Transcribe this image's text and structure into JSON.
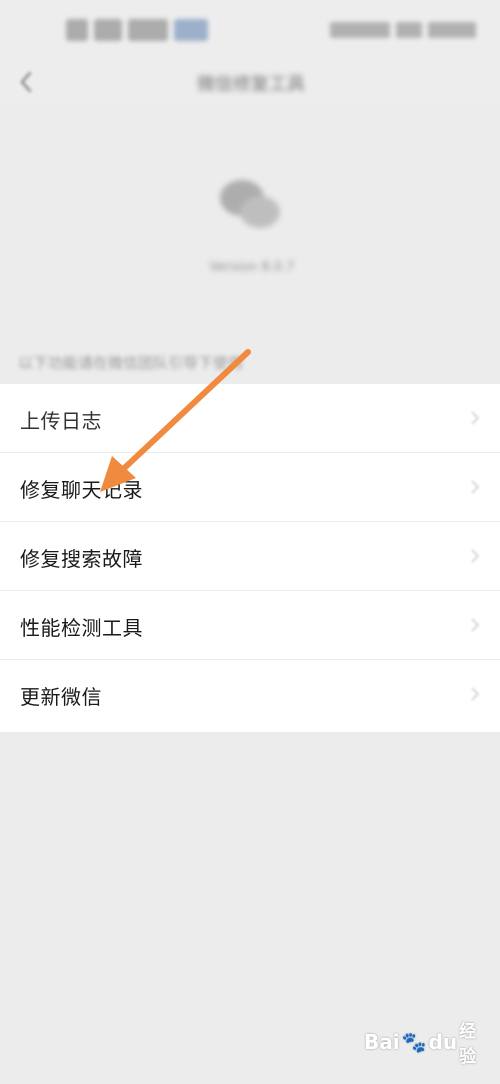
{
  "status_bar": {
    "time": "",
    "battery": ""
  },
  "nav": {
    "title": "微信修复工具",
    "back_icon": "chevron-left-icon"
  },
  "header": {
    "logo_icon": "wechat-logo-icon",
    "version": "Version 8.0.7"
  },
  "hint": "以下功能请在微信团队引导下使用",
  "menu": {
    "items": [
      {
        "label": "上传日志"
      },
      {
        "label": "修复聊天记录"
      },
      {
        "label": "修复搜索故障"
      },
      {
        "label": "性能检测工具"
      },
      {
        "label": "更新微信"
      }
    ],
    "chevron_icon": "chevron-right-icon"
  },
  "annotation": {
    "arrow_color": "#f08a3e",
    "arrow_icon": "annotation-arrow-icon"
  },
  "watermark": {
    "latin": "Bai",
    "paw": "du",
    "cn": "经验"
  },
  "colors": {
    "background": "#ececec",
    "list_background": "#ffffff",
    "text": "#1a1a1a",
    "accent_arrow": "#f08a3e"
  }
}
